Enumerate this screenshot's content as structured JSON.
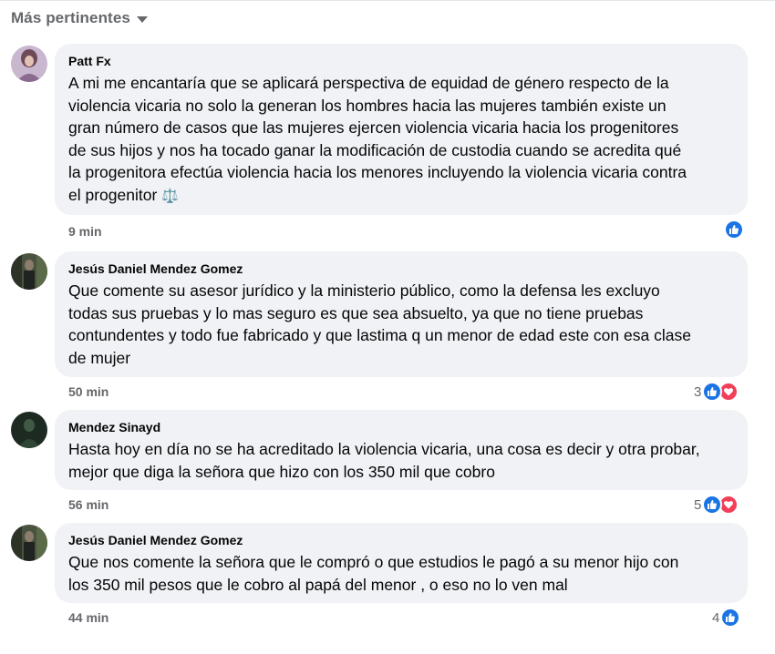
{
  "header": {
    "sort_label": "Más pertinentes"
  },
  "comments": [
    {
      "author": "Patt Fx",
      "text": "A mi me encantaría que se aplicará perspectiva de equidad de género respecto de la\nviolencia vicaria no solo la generan los hombres hacia las mujeres también existe un\ngran número de casos que las mujeres ejercen violencia vicaria hacia los progenitores\nde sus hijos y nos ha tocado ganar la modificación de custodia cuando se acredita qué\nla progenitora efectúa violencia hacia los menores incluyendo la violencia vicaria contra\nel progenitor",
      "emoji": "⚖️",
      "time": "9 min",
      "reaction_count": "",
      "reactions": [
        "like"
      ]
    },
    {
      "author": "Jesús Daniel Mendez Gomez",
      "text": "Que comente su asesor jurídico y la ministerio público, como la defensa les excluyo\ntodas sus pruebas y lo mas seguro es que sea absuelto, ya que no tiene pruebas\ncontundentes y todo fue fabricado y que lastima q un menor de edad este con esa clase\nde mujer",
      "time": "50 min",
      "reaction_count": "3",
      "reactions": [
        "like",
        "love"
      ]
    },
    {
      "author": "Mendez Sinayd",
      "text": "Hasta hoy en día no se ha acreditado la violencia vicaria, una cosa es decir y otra probar,\nmejor que diga la señora que hizo con los 350 mil que cobro",
      "time": "56 min",
      "reaction_count": "5",
      "reactions": [
        "like",
        "love"
      ]
    },
    {
      "author": "Jesús Daniel Mendez Gomez",
      "text": "Que nos comente la señora que le compró o que estudios le pagó a su menor hijo con\nlos 350 mil pesos que le cobro al papá del menor , o eso no lo ven mal",
      "time": "44 min",
      "reaction_count": "4",
      "reactions": [
        "like"
      ]
    }
  ],
  "colors": {
    "bubble": "#f0f2f5",
    "like": "#1b74e4",
    "love": "#f33e58",
    "meta": "#65676b"
  }
}
